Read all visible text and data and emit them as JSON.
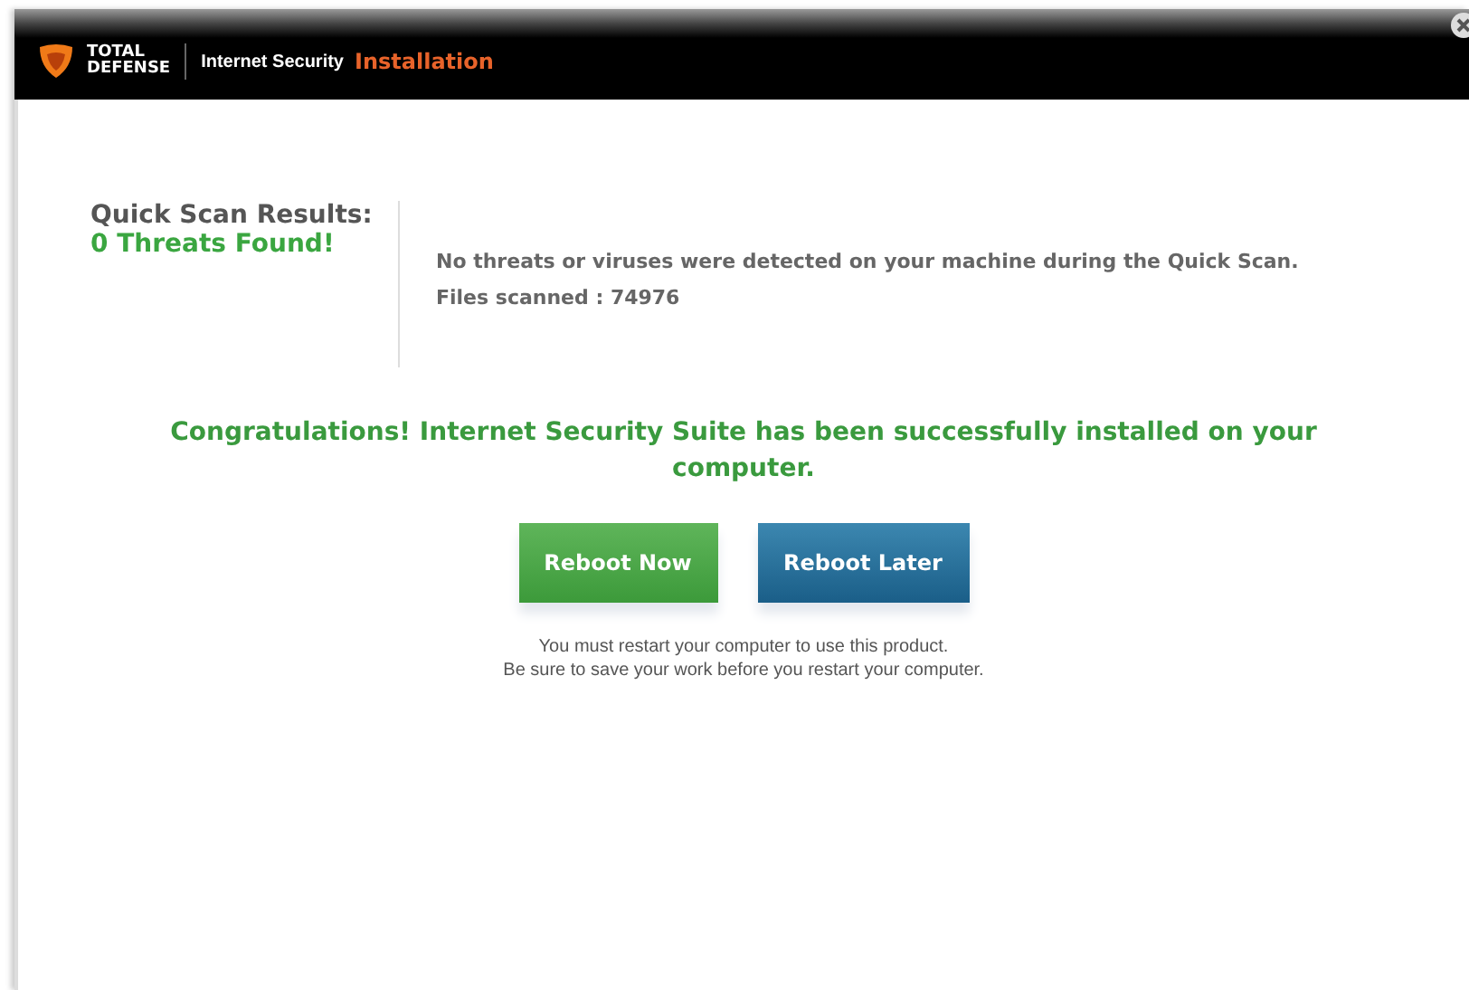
{
  "window": {
    "brand": [
      "TOTAL",
      "DEFENSE"
    ],
    "product": "Internet Security",
    "title": "Installation"
  },
  "scan": {
    "heading": "Quick Scan Results:",
    "result": "0 Threats Found!",
    "message": "No threats or viruses were detected on your machine during the Quick Scan.",
    "files": "Files scanned : 74976"
  },
  "congrats": "Congratulations! Internet Security Suite has been successfully installed on your computer.",
  "buttons": [
    {
      "label": "Reboot Now",
      "kind": "primary"
    },
    {
      "label": "Reboot Later",
      "kind": "secondary"
    }
  ],
  "notes": [
    "You must restart your computer to use this product.",
    "Be sure to save your work before you restart your computer."
  ]
}
